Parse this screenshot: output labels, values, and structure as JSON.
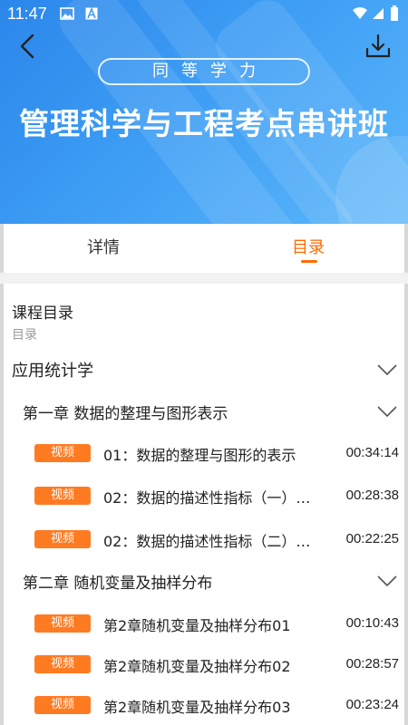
{
  "status": {
    "time": "11:47"
  },
  "banner": {
    "badge": "同等学力",
    "title": "管理科学与工程考点串讲班"
  },
  "tabs": [
    {
      "label": "详情",
      "active": false
    },
    {
      "label": "目录",
      "active": true
    }
  ],
  "catalog": {
    "heading": "课程目录",
    "subheading": "目录",
    "subject": "应用统计学",
    "chapters": [
      {
        "title": "第一章 数据的整理与图形表示",
        "lessons": [
          {
            "tag": "视频",
            "title": "01：数据的整理与图形的表示",
            "duration": "00:34:14"
          },
          {
            "tag": "视频",
            "title": "02：数据的描述性指标（一）…",
            "duration": "00:28:38"
          },
          {
            "tag": "视频",
            "title": "02：数据的描述性指标（二）…",
            "duration": "00:22:25"
          }
        ]
      },
      {
        "title": "第二章 随机变量及抽样分布",
        "lessons": [
          {
            "tag": "视频",
            "title": "第2章随机变量及抽样分布01",
            "duration": "00:10:43"
          },
          {
            "tag": "视频",
            "title": "第2章随机变量及抽样分布02",
            "duration": "00:28:57"
          },
          {
            "tag": "视频",
            "title": "第2章随机变量及抽样分布03",
            "duration": "00:23:24"
          }
        ]
      }
    ]
  },
  "colors": {
    "accent": "#ff6a00",
    "tag_bg": "#ff7b22",
    "banner": "#3d9df4"
  }
}
